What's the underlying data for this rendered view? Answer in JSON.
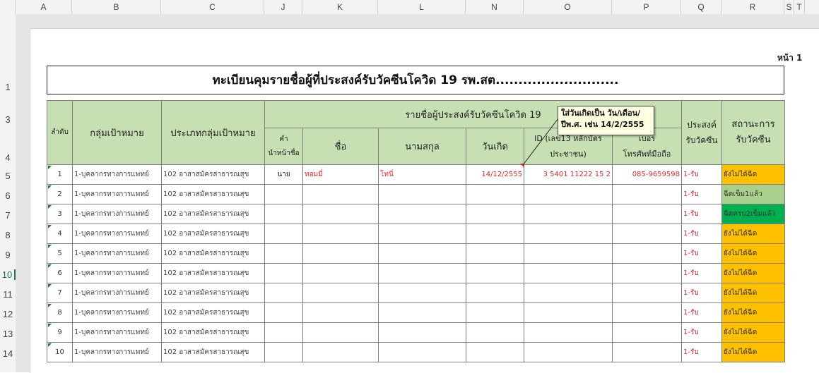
{
  "columns": [
    "A",
    "B",
    "C",
    "J",
    "K",
    "L",
    "N",
    "O",
    "P",
    "Q",
    "R",
    "S",
    "T"
  ],
  "rows": [
    "1",
    "3",
    "4",
    "5",
    "6",
    "7",
    "8",
    "9",
    "10",
    "11",
    "12",
    "13",
    "14"
  ],
  "selected_row": "10",
  "page_label": "หน้า 1",
  "title": "ทะเบียนคุมรายชื่อผู้ที่ประสงค์รับวัคซีนโควิด 19   รพ.สต...........................",
  "headers": {
    "order": "ลำดับ",
    "target_group": "กลุ่มเป้าหมาย",
    "target_type": "ประเภทกลุ่มเป้าหมาย",
    "names_group": "รายชื่อผู้ประสงค์รับวัคซีนโควิด 19",
    "prefix_line1": "คำ",
    "prefix_line2": "นำหน้าชื่อ",
    "first_name": "ชื่อ",
    "last_name": "นามสกุล",
    "birthdate": "วันเกิด",
    "id_line1": "ID (เลข13 หลักบัตร",
    "id_line2": "ประชาชน)",
    "phone_line1": "เบอร",
    "phone_line2": "โทรศัพท์มือถือ",
    "intent_line1": "ประสงค์",
    "intent_line2": "รับวัคซีน",
    "status_line1": "สถานะการ",
    "status_line2": "รับวัคซีน"
  },
  "comment": {
    "line1": "ใส่วันเกิดเป็น วัน/เดือน/",
    "line2": "ปีพ.ศ. เช่น 14/2/2555"
  },
  "records": [
    {
      "no": "1",
      "group": "1-บุคลากรทางการแพทย์",
      "type": "102 อาสาสมัครสาธารณสุข",
      "prefix": "นาย",
      "first": "ทอมมี่",
      "last": "โทนี่",
      "birth": "14/12/2555",
      "id": "3 5401 11222 15 2",
      "phone": "085-9659598",
      "intent": "1-รับ",
      "status": "ยังไม่ได้ฉีด"
    },
    {
      "no": "2",
      "group": "1-บุคลากรทางการแพทย์",
      "type": "102 อาสาสมัครสาธารณสุข",
      "prefix": "",
      "first": "",
      "last": "",
      "birth": "",
      "id": "",
      "phone": "",
      "intent": "1-รับ",
      "status": "ฉีดเข็ม1แล้ว"
    },
    {
      "no": "3",
      "group": "1-บุคลากรทางการแพทย์",
      "type": "102 อาสาสมัครสาธารณสุข",
      "prefix": "",
      "first": "",
      "last": "",
      "birth": "",
      "id": "",
      "phone": "",
      "intent": "1-รับ",
      "status": "ฉีดครบ2เข็มแล้ว"
    },
    {
      "no": "4",
      "group": "1-บุคลากรทางการแพทย์",
      "type": "102 อาสาสมัครสาธารณสุข",
      "prefix": "",
      "first": "",
      "last": "",
      "birth": "",
      "id": "",
      "phone": "",
      "intent": "1-รับ",
      "status": "ยังไม่ได้ฉีด"
    },
    {
      "no": "5",
      "group": "1-บุคลากรทางการแพทย์",
      "type": "102 อาสาสมัครสาธารณสุข",
      "prefix": "",
      "first": "",
      "last": "",
      "birth": "",
      "id": "",
      "phone": "",
      "intent": "1-รับ",
      "status": "ยังไม่ได้ฉีด"
    },
    {
      "no": "6",
      "group": "1-บุคลากรทางการแพทย์",
      "type": "102 อาสาสมัครสาธารณสุข",
      "prefix": "",
      "first": "",
      "last": "",
      "birth": "",
      "id": "",
      "phone": "",
      "intent": "1-รับ",
      "status": "ยังไม่ได้ฉีด"
    },
    {
      "no": "7",
      "group": "1-บุคลากรทางการแพทย์",
      "type": "102 อาสาสมัครสาธารณสุข",
      "prefix": "",
      "first": "",
      "last": "",
      "birth": "",
      "id": "",
      "phone": "",
      "intent": "1-รับ",
      "status": "ยังไม่ได้ฉีด"
    },
    {
      "no": "8",
      "group": "1-บุคลากรทางการแพทย์",
      "type": "102 อาสาสมัครสาธารณสุข",
      "prefix": "",
      "first": "",
      "last": "",
      "birth": "",
      "id": "",
      "phone": "",
      "intent": "1-รับ",
      "status": "ยังไม่ได้ฉีด"
    },
    {
      "no": "9",
      "group": "1-บุคลากรทางการแพทย์",
      "type": "102 อาสาสมัครสาธารณสุข",
      "prefix": "",
      "first": "",
      "last": "",
      "birth": "",
      "id": "",
      "phone": "",
      "intent": "1-รับ",
      "status": "ยังไม่ได้ฉีด"
    },
    {
      "no": "10",
      "group": "1-บุคลากรทางการแพทย์",
      "type": "102 อาสาสมัครสาธารณสุข",
      "prefix": "",
      "first": "",
      "last": "",
      "birth": "",
      "id": "",
      "phone": "",
      "intent": "1-รับ",
      "status": "ยังไม่ได้ฉีด"
    }
  ],
  "colors": {
    "header_fill": "#c6e0b4",
    "status_not_vaccinated": "#ffc000",
    "status_dose1": "#a9d08e",
    "status_dose2": "#00b050",
    "red_text": "#e6282b"
  }
}
